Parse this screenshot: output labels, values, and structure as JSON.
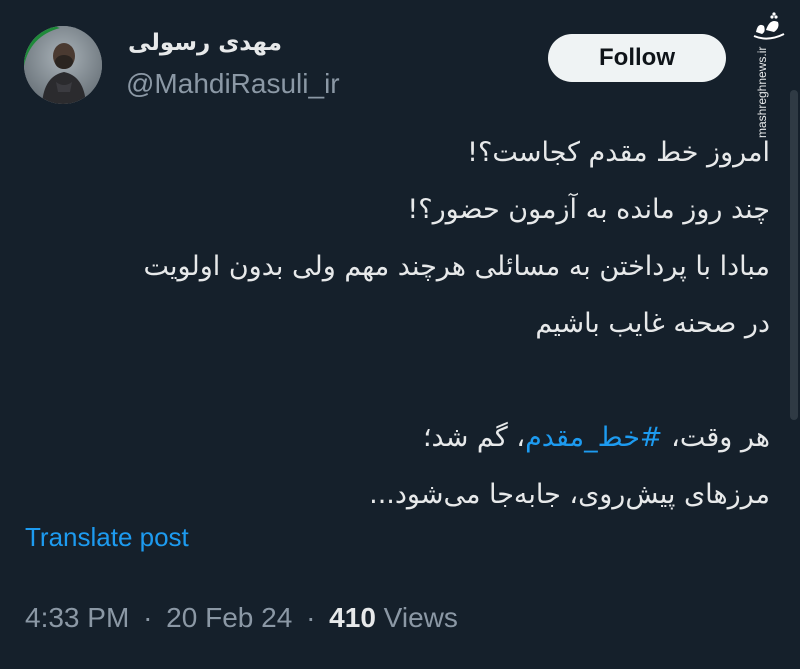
{
  "author": {
    "display_name": "مهدی رسولی",
    "handle": "@MahdiRasuli_ir",
    "avatar_icon": "profile-photo"
  },
  "follow_button": {
    "label": "Follow"
  },
  "watermark": {
    "logo_text": "مشرق",
    "url": "mashreghnews.ir"
  },
  "tweet": {
    "lines": [
      "امروز خط مقدم کجاست؟!",
      "چند روز مانده به آزمون حضور؟!",
      "مبادا با پرداختن به مسائلی هرچند مهم ولی بدون اولویت",
      "در صحنه غایب باشیم"
    ],
    "line5_prefix": "هر وقت، ",
    "hashtag": "#خط_مقدم",
    "line5_suffix": "، گم شد؛",
    "line6": "مرزهای پیش‌روی، جابه‌جا می‌شود..."
  },
  "translate_label": "Translate post",
  "meta": {
    "time": "4:33 PM",
    "separator": "·",
    "date": "20 Feb 24",
    "views_count": "410",
    "views_label": "Views"
  },
  "colors": {
    "background": "#15202b",
    "text": "#e7e9ea",
    "secondary_text": "#8b98a5",
    "accent": "#1d9bf0",
    "follow_bg": "#eff3f4"
  }
}
